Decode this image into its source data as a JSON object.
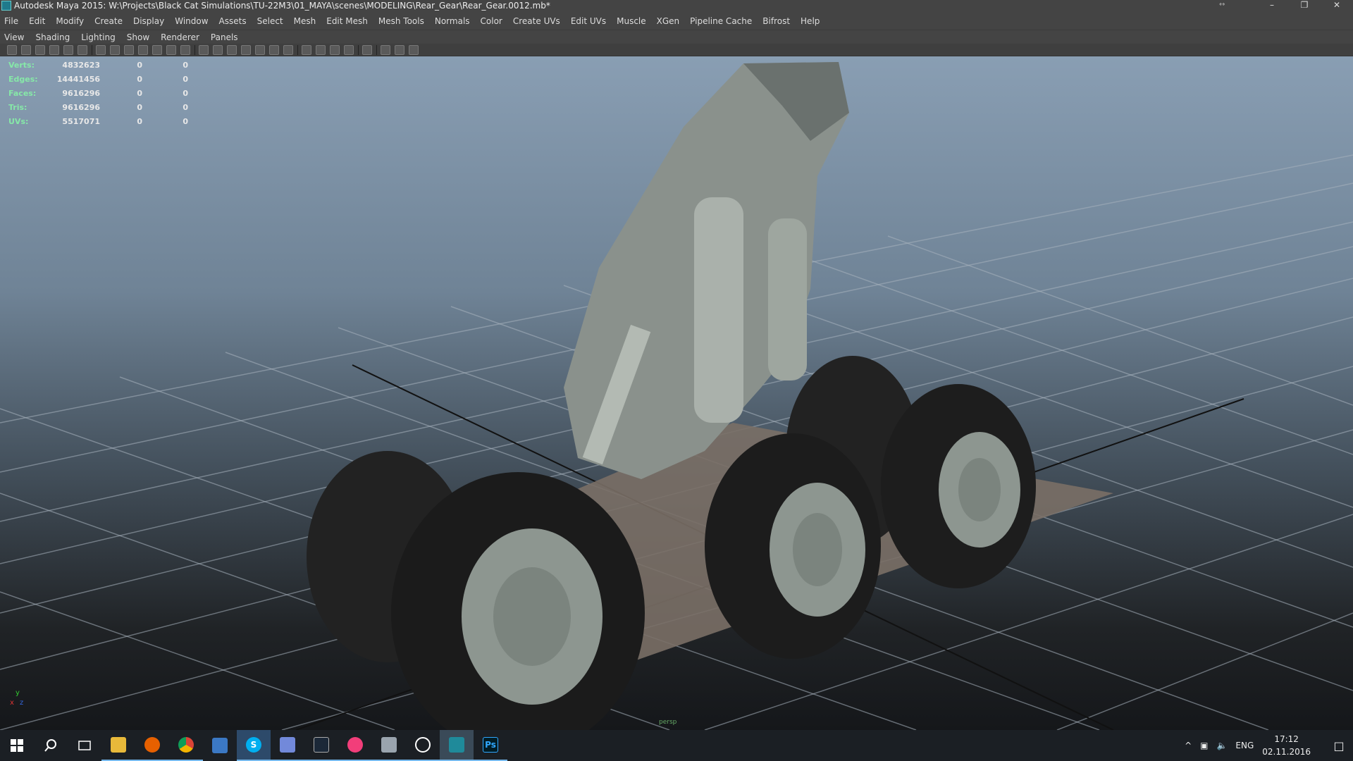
{
  "window": {
    "title": "Autodesk Maya 2015: W:\\Projects\\Black Cat Simulations\\TU-22M3\\01_MAYA\\scenes\\MODELING\\Rear_Gear\\Rear_Gear.0012.mb*",
    "controls": {
      "minimize": "–",
      "restore": "❐",
      "close": "✕"
    },
    "grip": "↔"
  },
  "menubar": [
    "File",
    "Edit",
    "Modify",
    "Create",
    "Display",
    "Window",
    "Assets",
    "Select",
    "Mesh",
    "Edit Mesh",
    "Mesh Tools",
    "Normals",
    "Color",
    "Create UVs",
    "Edit UVs",
    "Muscle",
    "XGen",
    "Pipeline Cache",
    "Bifrost",
    "Help"
  ],
  "panel_menu": [
    "View",
    "Shading",
    "Lighting",
    "Show",
    "Renderer",
    "Panels"
  ],
  "hud": {
    "rows": [
      {
        "label": "Verts:",
        "v1": "4832623",
        "v2": "0",
        "v3": "0"
      },
      {
        "label": "Edges:",
        "v1": "14441456",
        "v2": "0",
        "v3": "0"
      },
      {
        "label": "Faces:",
        "v1": "9616296",
        "v2": "0",
        "v3": "0"
      },
      {
        "label": "Tris:",
        "v1": "9616296",
        "v2": "0",
        "v3": "0"
      },
      {
        "label": "UVs:",
        "v1": "5517071",
        "v2": "0",
        "v3": "0"
      }
    ]
  },
  "viewport": {
    "camera_label": "persp",
    "axis": {
      "x": "x",
      "y": "y",
      "z": "z"
    }
  },
  "taskbar": {
    "apps": [
      "windows-start",
      "search",
      "task-view",
      "file-explorer",
      "firefox",
      "chrome",
      "edge-shell",
      "skype",
      "discord",
      "steam",
      "itunes",
      "mail",
      "sync",
      "maya",
      "photoshop"
    ],
    "photoshop_label": "Ps",
    "skype_label": "S",
    "tray": {
      "chevron": "^",
      "lang": "ENG"
    },
    "time": "17:12",
    "date": "02.11.2016"
  },
  "colors": {
    "hud_label": "#86e8a8",
    "accent": "#76b9ed"
  }
}
